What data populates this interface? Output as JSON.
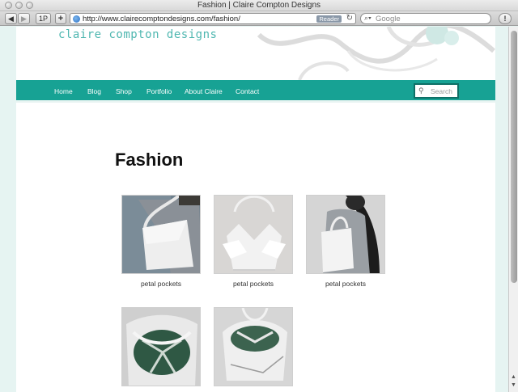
{
  "window": {
    "title": "Fashion | Claire Compton Designs"
  },
  "toolbar": {
    "back_icon": "back-arrow-icon",
    "forward_icon": "forward-arrow-icon",
    "onepassword_label": "1P",
    "add_icon": "plus-icon",
    "url": "http://www.clairecomptondesigns.com/fashion/",
    "reader_label": "Reader",
    "search_placeholder": "Google"
  },
  "site": {
    "brand": "claire compton designs",
    "nav": [
      {
        "label": "Home"
      },
      {
        "label": "Blog"
      },
      {
        "label": "Shop"
      },
      {
        "label": "Portfolio"
      },
      {
        "label": "About Claire"
      },
      {
        "label": "Contact"
      }
    ],
    "search_placeholder": "Search",
    "accent": "#17a294",
    "brand_color": "#4fb7b0"
  },
  "content": {
    "title": "Fashion",
    "items": [
      {
        "caption": "petal pockets"
      },
      {
        "caption": "petal pockets"
      },
      {
        "caption": "petal pockets"
      },
      {
        "caption": ""
      },
      {
        "caption": ""
      }
    ]
  }
}
